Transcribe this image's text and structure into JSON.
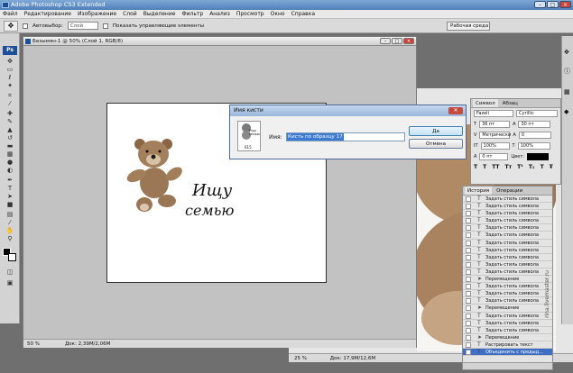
{
  "app": {
    "title": "Adobe Photoshop CS3 Extended"
  },
  "menu": [
    "Файл",
    "Редактирование",
    "Изображение",
    "Слой",
    "Выделение",
    "Фильтр",
    "Анализ",
    "Просмотр",
    "Окно",
    "Справка"
  ],
  "options": {
    "autoselect_label": "Автовыбор:",
    "autoselect_value": "Слой",
    "show_controls_label": "Показать управляющие элементы",
    "workspace_label": "Рабочая среда"
  },
  "doc1": {
    "title": "Безымян-1 @ 50% (Слой 1, RGB/8)",
    "zoom": "50 %",
    "docsize": "Док: 2,39M/2,06M",
    "line1": "Ищу",
    "line2": "семью"
  },
  "doc2": {
    "zoom": "25 %",
    "docsize": "Док: 17,9M/12,6M"
  },
  "dialog": {
    "title": "Имя кисти",
    "name_label": "Имя:",
    "name_value": "Кисть по образцу 17",
    "ok": "Да",
    "cancel": "Отмена",
    "thumb_text": "Ищу семью",
    "thumb_num": "615"
  },
  "character": {
    "tabs": [
      "Символ",
      "Абзац"
    ],
    "font": "Fazeli",
    "style": "Cyrillic",
    "size": "36 пт",
    "leading": "30 пт",
    "kerning": "Метрически",
    "tracking": "0",
    "vscale": "100%",
    "hscale": "100%",
    "baseline": "0 пт",
    "color_label": "Цвет:"
  },
  "history": {
    "tabs": [
      "История",
      "Операции"
    ],
    "items": [
      "Задать стиль символа",
      "Задать стиль символа",
      "Задать стиль символа",
      "Задать стиль символа",
      "Задать стиль символа",
      "Задать стиль символа",
      "Задать стиль символа",
      "Задать стиль символа",
      "Задать стиль символа",
      "Задать стиль символа",
      "Задать стиль символа",
      "Перемещение",
      "Задать стиль символа",
      "Задать стиль символа",
      "Задать стиль символа",
      "Перемещение",
      "Задать стиль символа",
      "Задать стиль символа",
      "Задать стиль символа",
      "Перемещение",
      "Растрировать текст",
      "Объединить с предыд..."
    ],
    "selected": 21
  },
  "watermark": "rina.livemaster.ru"
}
